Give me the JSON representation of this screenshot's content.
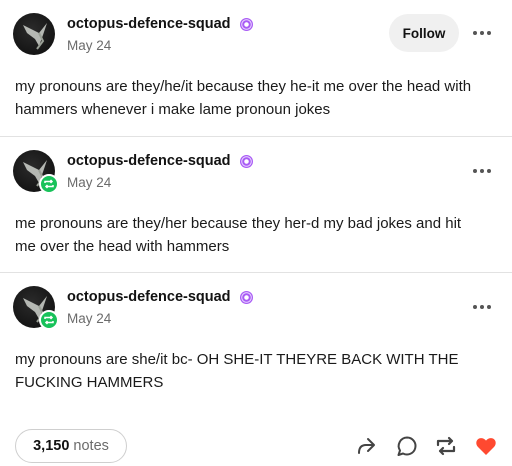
{
  "posts": [
    {
      "username": "octopus-defence-squad",
      "date": "May 24",
      "follow_label": "Follow",
      "text_lines": [
        "my pronouns are they/he/it because they he-it me over the head with",
        "hammers whenever i make lame pronoun jokes"
      ]
    },
    {
      "username": "octopus-defence-squad",
      "date": "May 24",
      "text_lines": [
        "me pronouns are they/her because they her-d my bad jokes and hit",
        "me over the head with hammers"
      ]
    },
    {
      "username": "octopus-defence-squad",
      "date": "May 24",
      "text_lines": [
        "my pronouns are she/it bc- OH SHE-IT THEYRE BACK WITH THE",
        "FUCKING HAMMERS"
      ]
    }
  ],
  "footer": {
    "notes_count": "3,150",
    "notes_label": "notes"
  },
  "icons": {
    "verified": "verified-badge-icon",
    "more": "more-options-icon",
    "reblog_badge": "reblog-icon",
    "share": "share-icon",
    "reply": "reply-icon",
    "reblog": "reblog-icon",
    "like": "heart-icon"
  },
  "colors": {
    "reblog_green": "#18c25a",
    "like_red": "#ff4930",
    "verified_purple": "#a95cf5"
  }
}
